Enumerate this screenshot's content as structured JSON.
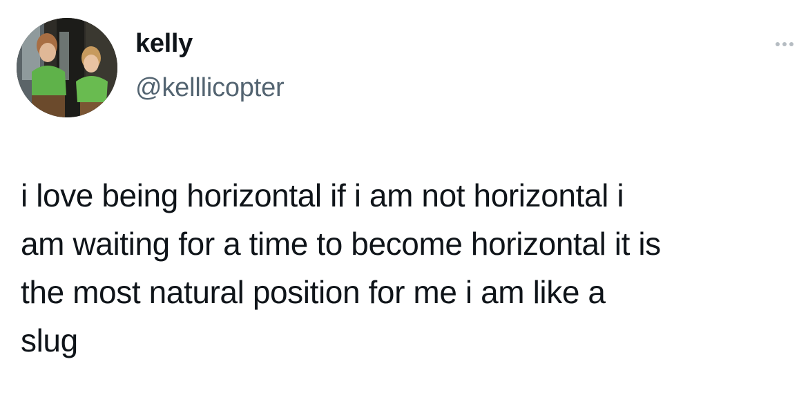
{
  "tweet": {
    "author": {
      "display_name": "kelly",
      "handle": "@kelllicopter",
      "avatar_icon": "profile-photo"
    },
    "more_icon": "more-horizontal-icon",
    "text_lines": [
      "i love being horizontal if i am not horizontal i",
      "am waiting for a time to become horizontal it is",
      "the most natural position for me i am like a",
      "slug"
    ]
  },
  "colors": {
    "text": "#0f1419",
    "secondary_text": "#536471",
    "more_dots": "#b5bcc2",
    "background": "#ffffff"
  }
}
